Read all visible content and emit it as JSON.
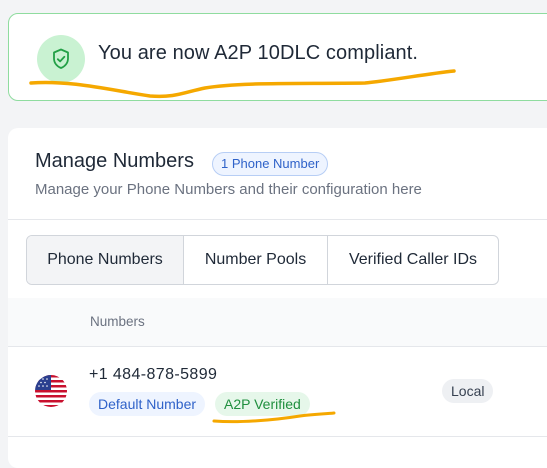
{
  "banner": {
    "message": "You are now A2P 10DLC compliant.",
    "icon": "shield-check-icon",
    "accent_color": "#22c55e"
  },
  "manage": {
    "title": "Manage Numbers",
    "count_badge": "1 Phone Number",
    "subtitle": "Manage your Phone Numbers and their configuration here"
  },
  "tabs": [
    {
      "label": "Phone Numbers",
      "active": true
    },
    {
      "label": "Number Pools",
      "active": false
    },
    {
      "label": "Verified Caller IDs",
      "active": false
    }
  ],
  "table": {
    "columns": [
      "Numbers"
    ],
    "rows": [
      {
        "flag": "us-flag-icon",
        "number": "+1 484-878-5899",
        "badges": [
          "Default Number",
          "A2P Verified"
        ],
        "type": "Local"
      }
    ]
  },
  "annotations": {
    "color": "#f5a800"
  }
}
